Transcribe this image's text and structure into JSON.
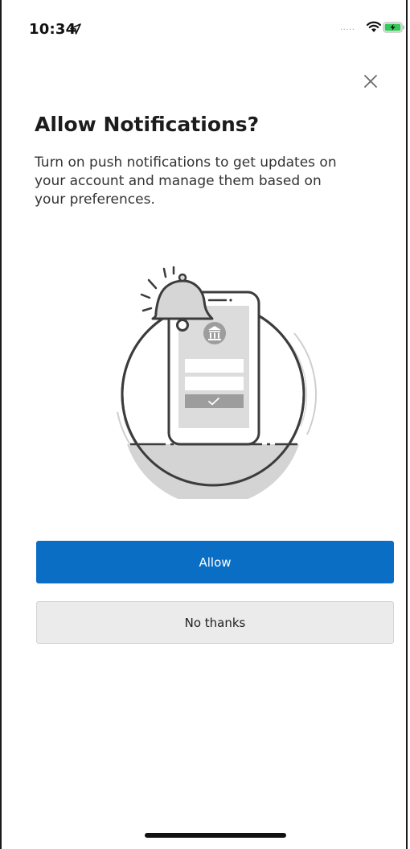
{
  "status_bar": {
    "time": "10:34",
    "signal": "....."
  },
  "dialog": {
    "title": "Allow Notifications?",
    "description": "Turn on push notifications to get updates on your account and manage them based on your preferences.",
    "allow_label": "Allow",
    "no_thanks_label": "No thanks"
  },
  "icons": {
    "location": "location-arrow-icon",
    "wifi": "wifi-icon",
    "battery": "battery-charging-icon",
    "close": "close-icon",
    "illustration": "phone-bell-bank-illustration"
  },
  "colors": {
    "primary": "#0a6ec5",
    "secondary_bg": "#ebebeb",
    "battery": "#34c759"
  }
}
